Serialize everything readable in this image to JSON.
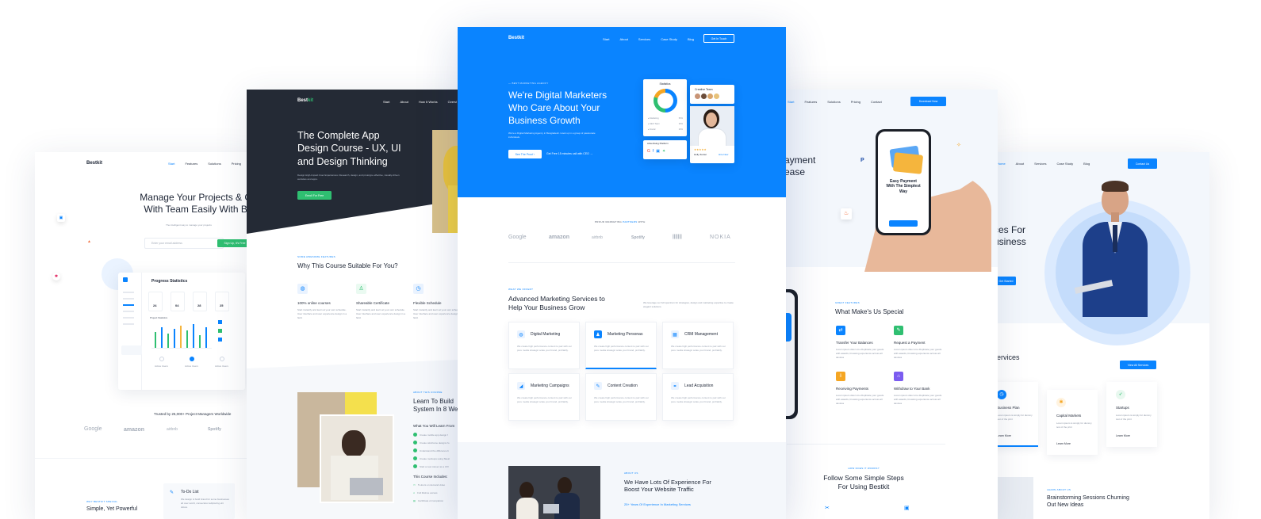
{
  "card1": {
    "logo": "Bestkit",
    "nav": [
      "Start",
      "Features",
      "Solutions",
      "Pricing"
    ],
    "hero_title": "Manage Your Projects & Co",
    "hero_title2": "With Team Easily With Be",
    "hero_sub": "The intelligent way to manage your projects",
    "email_placeholder": "Enter your email address",
    "signup_label": "Sign Up, It's Free",
    "dashboard": {
      "title": "Progress Statistics",
      "stats": [
        "24",
        "04",
        "28",
        "25"
      ],
      "chart_label": "Project Statistics",
      "progress_labels": [
        "Active Users",
        "Active Users",
        "Active Users"
      ]
    },
    "trusted": "Trusted by 25,000+ Project Managers Worldwide",
    "brands": [
      "Google",
      "amazon",
      "airbnb",
      "Spotify"
    ],
    "bottom_tag": "WHY BESTKIT SPECIAL",
    "bottom_title": "Simple, Yet Powerful",
    "todo_title": "To-Do List",
    "todo_text": "We design & build brand for some businesses all over world, consectetur adipiscing elit dolore"
  },
  "card2": {
    "logo_a": "Best",
    "logo_b": "kit",
    "nav": [
      "Start",
      "About",
      "How It Works",
      "Overvi"
    ],
    "hero_title": [
      "The Complete App",
      "Design Course - UX, UI",
      "and Design Thinking"
    ],
    "hero_sub": "Design High-Impact User Experiences. Research, design, and prototype effective, visually-driven websites and apps.",
    "cta": "Enroll For Free",
    "features_tag": "SOME AWESOME FEATURES",
    "features_title": "Why This Course Suitable For You?",
    "features": [
      {
        "title": "100% online courses",
        "text": "Start instantly and learn at your own schedule. User interface and user experience design in a field."
      },
      {
        "title": "Shareable Certificate",
        "text": "Start instantly and learn at your own schedule. User interface and user experience design in a field."
      },
      {
        "title": "Flexible Schedule",
        "text": "Start instantly and learn at your own schedule. User interface and user experience design in a field."
      }
    ],
    "about_tag": "ABOUT THIS COURSE",
    "about_title": [
      "Learn To Build",
      "System In 8 We"
    ],
    "learn_title": "What You Will Learn From",
    "learn_items": [
      "Create mobile app design f",
      "Create wireframe designs fo",
      "Understand the difference b",
      "Create mockups using Sketc",
      "Start a new career as a UX/"
    ],
    "includes_title": "This Course Includes:",
    "includes": [
      "5 Hours on demand video",
      "Full lifetime access",
      "Certificate of completion"
    ]
  },
  "card3": {
    "logo": "Bestkit",
    "nav": [
      "Start",
      "About",
      "Services",
      "Case Study",
      "Blog"
    ],
    "nav_cta": "Get In Touch",
    "hero_tag": "BEST MARKETING AGENCY",
    "hero_title": [
      "We're Digital Marketers",
      "Who Care About Your",
      "Business Growth"
    ],
    "hero_sub": "We're a Digital Marketing Agency in Bangladesh. Hook up in a group of passionate individuals.",
    "cta_primary": "See The Proof",
    "cta_secondary": "Get Free 15 minutes call with CEO",
    "stats_card_title": "Statistics",
    "stats_rows": [
      {
        "label": "Marketing",
        "value": "50%"
      },
      {
        "label": "SEO Team",
        "value": "30%"
      },
      {
        "label": "Social",
        "value": "20%"
      }
    ],
    "creative_team": "Creative Team",
    "platform_title": "Advertising Platform",
    "person_name": "Holly Zenter",
    "person_link": "Hire Now",
    "proud_pre": "PROUD MARKETING ",
    "proud_hl": "PARTNERS",
    "proud_post": " WITH",
    "partners": [
      "Google",
      "amazon",
      "airbnb",
      "Spotify",
      "|||||||",
      "NOKIA"
    ],
    "services_tag": "WHAT WE OFFER?",
    "services_title": [
      "Advanced Marketing Services to",
      "Help Your Business Grow"
    ],
    "services_sub": "We leverage our full spectrum for strategies, design and marketing expertise to create elegant solutions.",
    "services": [
      {
        "title": "Digital Marketing",
        "icon": "globe-icon",
        "text": "We create high performance content to pair with our pure media strategic scale your brand, profitably."
      },
      {
        "title": "Marketing Personas",
        "icon": "users-icon",
        "text": "We create high performance content to pair with our pure media strategic scale your brand, profitably."
      },
      {
        "title": "CRM Management",
        "icon": "grid-icon",
        "text": "We create high performance content to pair with our pure media strategic scale your brand, profitably."
      },
      {
        "title": "Marketing Campaigns",
        "icon": "chart-icon",
        "text": "We create high performance content to pair with our pure media strategic scale your brand, profitably."
      },
      {
        "title": "Content Creation",
        "icon": "edit-icon",
        "text": "We create high performance content to pair with our pure media strategic scale your brand, profitably."
      },
      {
        "title": "Lead Acquisition",
        "icon": "link-icon",
        "text": "We create high performance content to pair with our pure media strategic scale your brand, profitably."
      }
    ],
    "about_tag": "ABOUT US",
    "about_title": [
      "We Have Lots Of Experience For",
      "Boost Your Website Traffic"
    ],
    "about_sub": "25+ Years Of Experience In Marketing Services"
  },
  "card4": {
    "nav": [
      "Start",
      "Features",
      "Solutions",
      "Pricing",
      "Contact"
    ],
    "cta": "Download Now",
    "hero_title": [
      "ayment",
      "ease"
    ],
    "phone_title": [
      "Easy Payment",
      "With The Simplest",
      "Way"
    ],
    "special_tag": "GREAT FEATURES",
    "special_title": "What Make's Us Special",
    "features": [
      "Transfer Your Balances",
      "Request a Payment",
      "Receiving Payments",
      "Withdraw to Your Bank"
    ],
    "feature_text": "Lorem ipsum dolor sit a Duplicate your goods with awards, browsing experience across all devices",
    "steps_tag": "HOW DOES IT WORKS?",
    "steps_title": [
      "Follow Some Simple Steps",
      "For Using Bestkit"
    ]
  },
  "card5": {
    "nav": [
      "Home",
      "About",
      "Services",
      "Case Study",
      "Blog"
    ],
    "cta": "Contact Us",
    "hero_title": [
      "ces For",
      "usiness"
    ],
    "hero_cta": "Get Started",
    "services_title": "ervices",
    "view_all": "View All Services",
    "plans": [
      {
        "title": "Business Plan",
        "link": "Learn More"
      },
      {
        "title": "Capital Markets",
        "link": "Learn More"
      },
      {
        "title": "Startups",
        "link": "Learn More"
      }
    ],
    "learn_tag": "LEARN ABOUT US",
    "learn_title": [
      "Brainstorming Sessions Churning",
      "Out New Ideas"
    ]
  },
  "colors": {
    "accent": "#0a84ff",
    "dark": "#242a35",
    "green": "#2fbf71"
  }
}
